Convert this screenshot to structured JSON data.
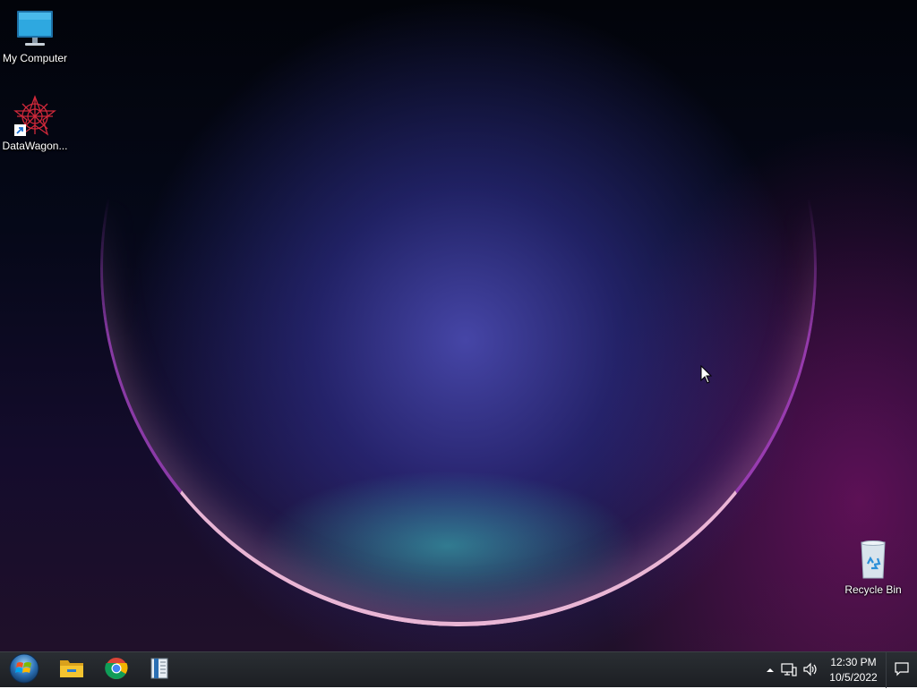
{
  "desktop": {
    "icons": [
      {
        "label": "My Computer",
        "icon": "monitor-icon"
      },
      {
        "label": "DataWagon...",
        "icon": "datawagon-shortcut-icon"
      },
      {
        "label": "Recycle Bin",
        "icon": "recycle-bin-icon"
      }
    ]
  },
  "taskbar": {
    "start_icon": "windows-start-orb-icon",
    "pinned": [
      {
        "icon": "file-explorer-icon"
      },
      {
        "icon": "chrome-icon"
      },
      {
        "icon": "archive-app-icon"
      }
    ],
    "tray": {
      "show_hidden_icon": "chevron-up-icon",
      "network_icon": "network-icon",
      "volume_icon": "volume-icon",
      "time": "12:30 PM",
      "date": "10/5/2022",
      "notification_icon": "action-center-icon"
    }
  },
  "colors": {
    "taskbar_bg": "#1f2226",
    "monitor_screen": "#2ea8e0",
    "folder_yellow": "#f4c430",
    "datawagon_red": "#d0283a"
  }
}
